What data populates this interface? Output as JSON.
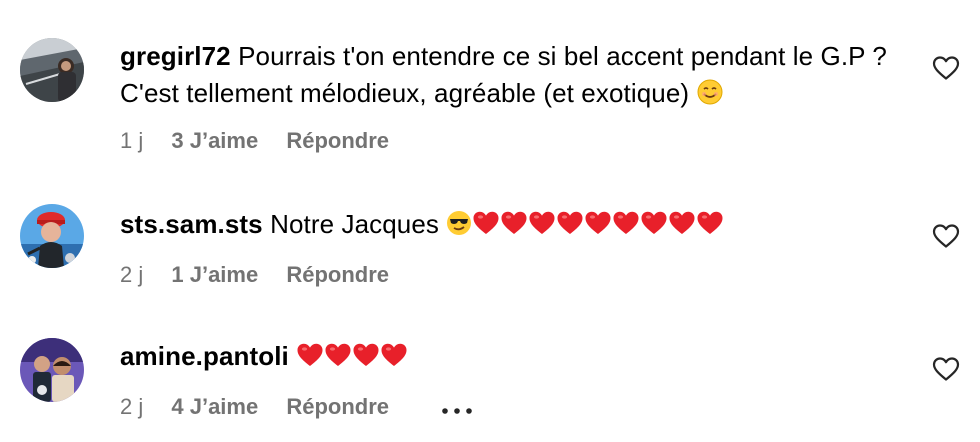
{
  "comments": [
    {
      "username": "gregirl72",
      "text": "Pourrais t'on entendre ce si bel accent pendant le G.P ? C'est tellement mélodieux, agréable (et exotique)",
      "emoji": "smiling-face-icon",
      "time": "1 j",
      "likes": "3 J’aime",
      "reply": "Répondre"
    },
    {
      "username": "sts.sam.sts",
      "text": "Notre Jacques",
      "emoji": "sunglasses-face-icon + 9 red-heart-icon",
      "time": "2 j",
      "likes": "1 J’aime",
      "reply": "Répondre"
    },
    {
      "username": "amine.pantoli",
      "text": "",
      "emoji": "4 red-heart-icon",
      "time": "2 j",
      "likes": "4 J’aime",
      "reply": "Répondre",
      "more": "more-options-icon"
    }
  ],
  "colors": {
    "text": "#000000",
    "meta": "#737373",
    "heart": "#e8202a"
  }
}
